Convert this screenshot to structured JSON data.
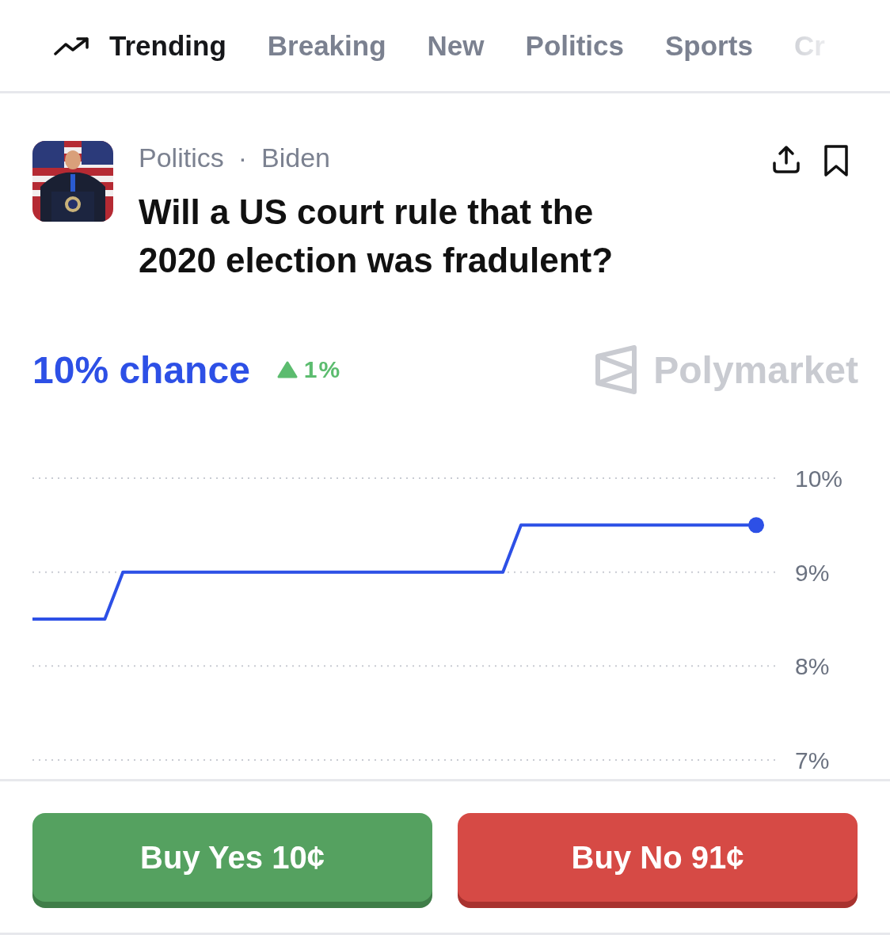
{
  "nav_tabs": [
    {
      "label": "Trending",
      "selected": true,
      "kind": "trend"
    },
    {
      "label": "Breaking",
      "selected": false,
      "kind": "text"
    },
    {
      "label": "New",
      "selected": false,
      "kind": "text"
    },
    {
      "label": "Politics",
      "selected": false,
      "kind": "text"
    },
    {
      "label": "Sports",
      "selected": false,
      "kind": "text"
    },
    {
      "label": "Cr",
      "selected": false,
      "kind": "text"
    }
  ],
  "market": {
    "category": "Politics",
    "separator": "·",
    "tag": "Biden",
    "title": "Will a US court rule that the 2020 election was fradulent?"
  },
  "odds": {
    "chance": "10% chance",
    "change": "1%",
    "rising": true,
    "brand": "Polymarket"
  },
  "chart": {
    "chart_data": {
      "type": "line",
      "series": [
        {
          "color": "#2d50e6",
          "values": [
            8.5,
            8.5,
            8.5,
            8.5,
            8.5,
            9,
            9,
            9,
            9,
            9,
            9,
            9,
            9,
            9,
            9,
            9,
            9,
            9,
            9,
            9,
            9,
            9,
            9,
            9,
            9,
            9,
            9,
            9.5,
            9.5,
            9.5,
            9.5,
            9.5,
            9.5,
            9.5,
            9.5,
            9.5,
            9.5,
            9.5,
            9.5,
            9.5,
            9.5
          ]
        }
      ],
      "ylim": [
        7,
        10
      ],
      "yticks": [
        {
          "value": 10,
          "label": "10%"
        },
        {
          "value": 9,
          "label": "9%"
        },
        {
          "value": 8,
          "label": "8%"
        },
        {
          "value": 7,
          "label": "7%"
        }
      ]
    }
  },
  "buttons": [
    {
      "label": "Buy Yes 10¢",
      "kind": "yes"
    },
    {
      "label": "Buy No 91¢",
      "kind": "no"
    }
  ]
}
